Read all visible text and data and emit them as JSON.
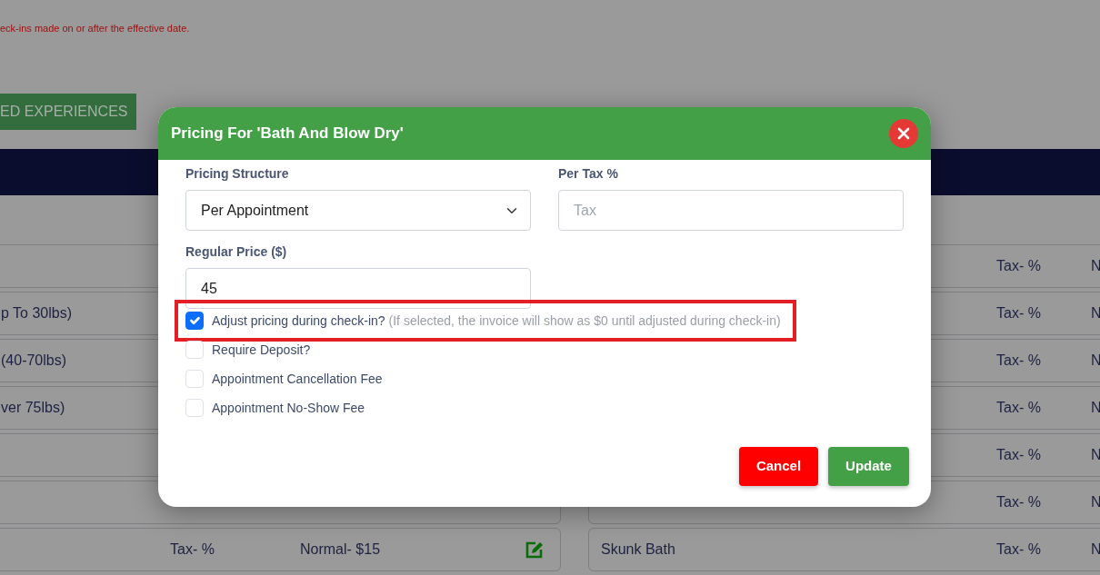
{
  "notice": "eck-ins made on or after the effective date.",
  "experiences_button": "ED EXPERIENCES",
  "rows_left": [
    {
      "kind": "blank"
    },
    {
      "kind": "named",
      "name": "p To 30lbs)"
    },
    {
      "kind": "named",
      "name": "(40-70lbs)"
    },
    {
      "kind": "named",
      "name": "ver 75lbs)"
    },
    {
      "kind": "blank"
    },
    {
      "kind": "blank"
    },
    {
      "kind": "priced",
      "tax": "Tax- %",
      "price": "Normal- $15"
    }
  ],
  "rows_right": [
    {
      "tax": "Tax- %",
      "column_4": "N"
    },
    {
      "tax": "Tax- %",
      "column_4": "N"
    },
    {
      "tax": "Tax- %",
      "column_4": "N"
    },
    {
      "tax": "Tax- %",
      "column_4": "N"
    },
    {
      "tax": "Tax- %",
      "column_4": "N"
    },
    {
      "tax": "Tax- %",
      "column_4": "N"
    },
    {
      "name": "Skunk Bath",
      "tax": "Tax- %",
      "column_4": "N"
    }
  ],
  "modal": {
    "title": "Pricing For 'Bath And Blow Dry'",
    "pricing_structure": {
      "label": "Pricing Structure",
      "value": "Per Appointment"
    },
    "tax": {
      "label": "Per Tax %",
      "placeholder": "Tax"
    },
    "regular_price": {
      "label": "Regular Price ($)",
      "value": "45"
    },
    "options": [
      {
        "label": "Adjust pricing during check-in?",
        "note": "(If selected, the invoice will show as $0 until adjusted during check-in)",
        "checked": true,
        "highlighted": true
      },
      {
        "label": "Require Deposit?",
        "checked": false,
        "highlighted": false
      },
      {
        "label": "Appointment Cancellation Fee",
        "checked": false,
        "highlighted": false
      },
      {
        "label": "Appointment No-Show Fee",
        "checked": false,
        "highlighted": false
      }
    ],
    "buttons": [
      {
        "label": "Cancel",
        "kind": "cancel"
      },
      {
        "label": "Update",
        "kind": "update"
      }
    ]
  }
}
